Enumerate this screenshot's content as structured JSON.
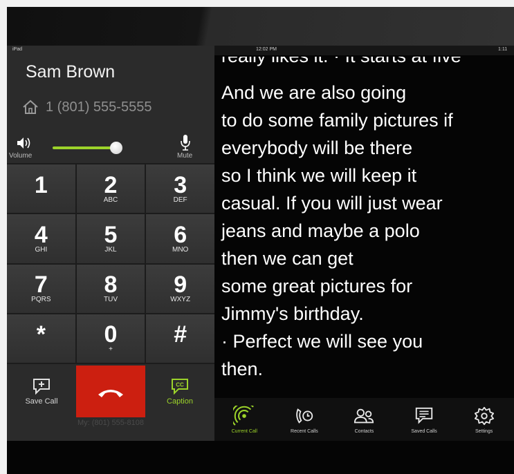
{
  "status_bar": {
    "left": "iPad",
    "center": "12:02 PM",
    "right": "1:11"
  },
  "caller": {
    "name": "Sam Brown",
    "number": "1 (801) 555-5555"
  },
  "volume": {
    "label": "Volume",
    "level": 0.92
  },
  "mute": {
    "label": "Mute"
  },
  "keypad": [
    {
      "digit": "1",
      "letters": ""
    },
    {
      "digit": "2",
      "letters": "ABC"
    },
    {
      "digit": "3",
      "letters": "DEF"
    },
    {
      "digit": "4",
      "letters": "GHI"
    },
    {
      "digit": "5",
      "letters": "JKL"
    },
    {
      "digit": "6",
      "letters": "MNO"
    },
    {
      "digit": "7",
      "letters": "PQRS"
    },
    {
      "digit": "8",
      "letters": "TUV"
    },
    {
      "digit": "9",
      "letters": "WXYZ"
    },
    {
      "digit": "*",
      "letters": ""
    },
    {
      "digit": "0",
      "letters": "+"
    },
    {
      "digit": "#",
      "letters": ""
    }
  ],
  "actions": {
    "save_call": "Save Call",
    "caption": "Caption"
  },
  "my_number": "My: (801) 555-8108",
  "captions": {
    "partial_line": "really likes it.  · It starts at five",
    "lines": [
      "And we are also going",
      "to do some family pictures if",
      "everybody will be there",
      "so I think we will keep it",
      "casual. If you will just wear",
      "jeans and maybe a polo",
      "then we can get",
      "some great pictures  for",
      "Jimmy's birthday.",
      " · Perfect we will see you",
      "then."
    ]
  },
  "tabs": [
    {
      "label": "Current Call",
      "icon": "current-call-icon",
      "active": true
    },
    {
      "label": "Recent Calls",
      "icon": "recent-calls-icon",
      "active": false
    },
    {
      "label": "Contacts",
      "icon": "contacts-icon",
      "active": false
    },
    {
      "label": "Saved Calls",
      "icon": "saved-calls-icon",
      "active": false
    },
    {
      "label": "Settings",
      "icon": "settings-icon",
      "active": false
    }
  ],
  "colors": {
    "accent": "#9cd32a",
    "hangup": "#cc1f10"
  }
}
